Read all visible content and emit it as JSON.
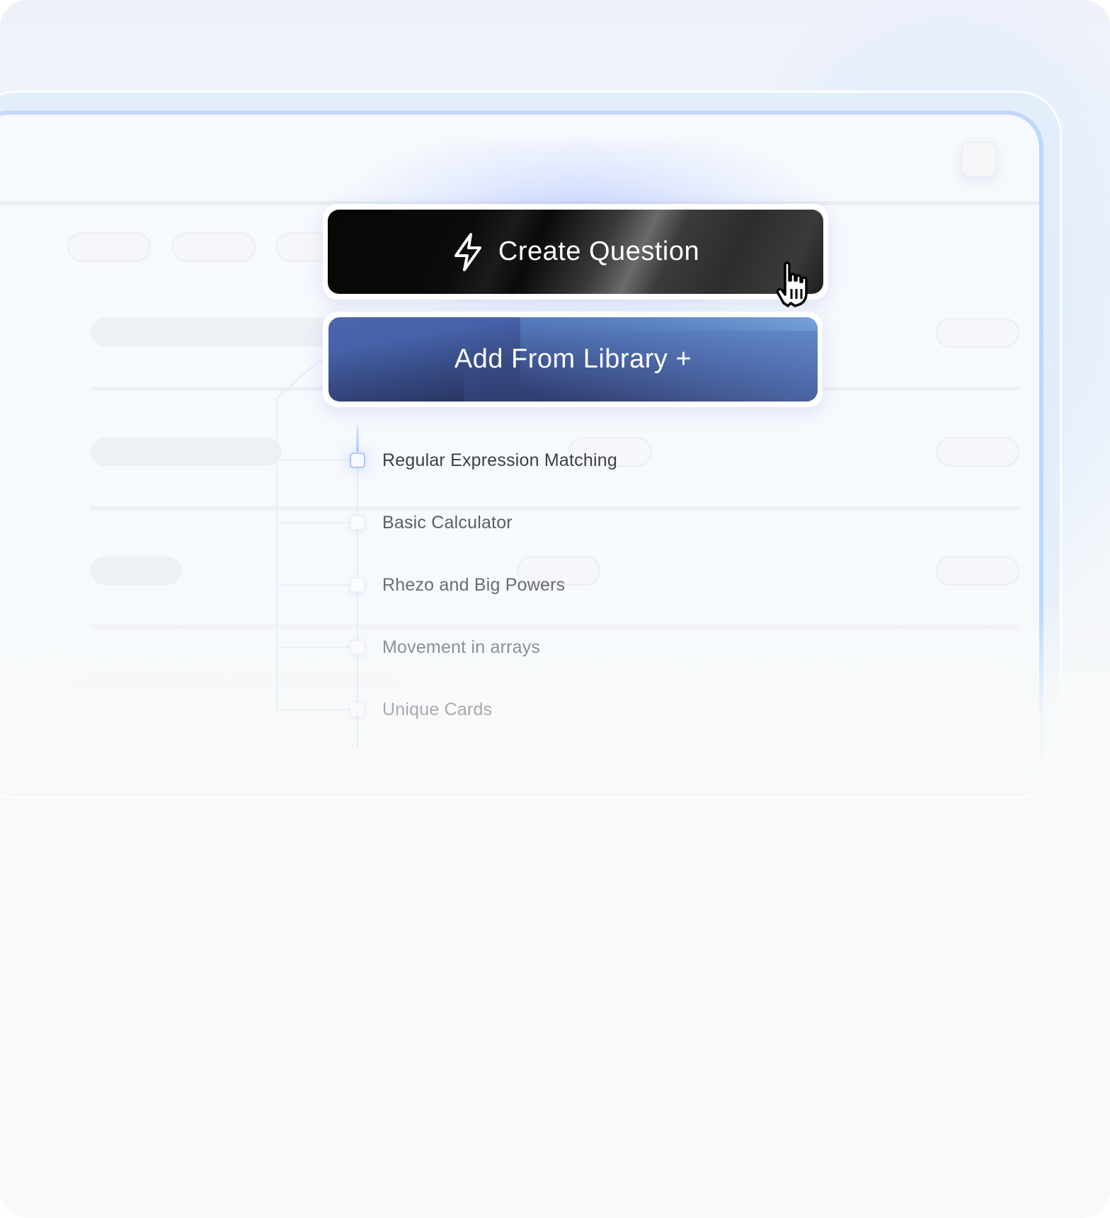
{
  "actions": {
    "create_question": {
      "label": "Create Question",
      "icon": "lightning-bolt-icon"
    },
    "add_from_library": {
      "label": "Add From Library +"
    }
  },
  "question_list": {
    "items": [
      {
        "label": "Regular Expression Matching",
        "checked": false,
        "highlighted": true,
        "color": "#3d3f45"
      },
      {
        "label": "Basic Calculator",
        "checked": false,
        "highlighted": false,
        "color": "#5c5e64"
      },
      {
        "label": "Rhezo and Big Powers",
        "checked": false,
        "highlighted": false,
        "color": "#6a6c72"
      },
      {
        "label": "Movement in arrays",
        "checked": false,
        "highlighted": false,
        "color": "#8d8f96"
      },
      {
        "label": "Unique Cards",
        "checked": false,
        "highlighted": false,
        "color": "#a7a9b0"
      }
    ]
  },
  "colors": {
    "accent_blue": "#a9c6f8",
    "button_dark": "#0a0a0a",
    "button_blue": "#4762a9"
  }
}
